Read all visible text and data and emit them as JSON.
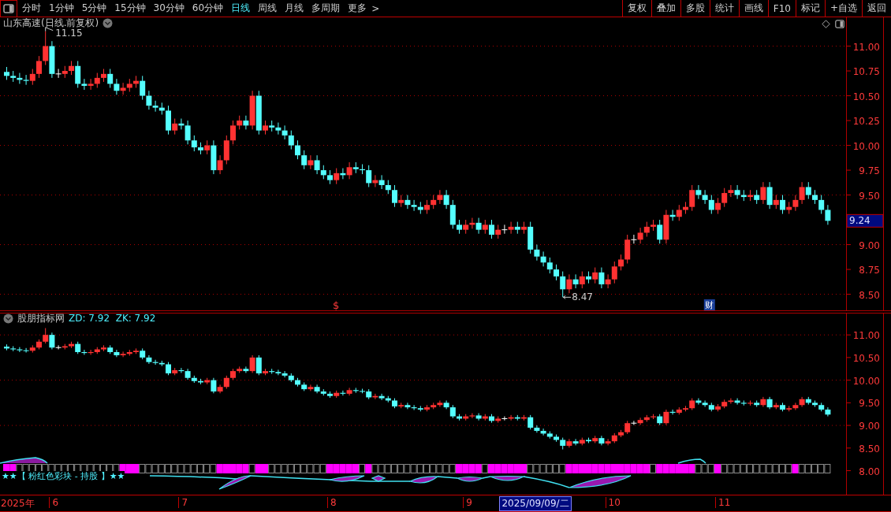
{
  "toolbar": {
    "periods": [
      {
        "label": "分时",
        "selected": false
      },
      {
        "label": "1分钟",
        "selected": false
      },
      {
        "label": "5分钟",
        "selected": false
      },
      {
        "label": "15分钟",
        "selected": false
      },
      {
        "label": "30分钟",
        "selected": false
      },
      {
        "label": "60分钟",
        "selected": false
      },
      {
        "label": "日线",
        "selected": true
      },
      {
        "label": "周线",
        "selected": false
      },
      {
        "label": "月线",
        "selected": false
      },
      {
        "label": "多周期",
        "selected": false
      }
    ],
    "more": "更多",
    "more_arrow": ">",
    "actions": [
      "复权",
      "叠加",
      "多股",
      "统计",
      "画线",
      "F10",
      "标记",
      "+自选",
      "返回"
    ]
  },
  "main_panel": {
    "title": "山东高速(日线.前复权)",
    "last_price": "9.24",
    "markers": [
      {
        "kind": "dollar",
        "text": "$"
      },
      {
        "kind": "finance",
        "text": "财"
      }
    ],
    "chart_data": {
      "type": "candlestick",
      "grid": true,
      "ylim": [
        8.33,
        11.29
      ],
      "categories": [
        null,
        null,
        null,
        null,
        null,
        null,
        null,
        null,
        null,
        null,
        null,
        null,
        null,
        null,
        null,
        null,
        null,
        null,
        null,
        null,
        null,
        null,
        null,
        null,
        null,
        null,
        null,
        null,
        null,
        null,
        null,
        null,
        null,
        null,
        null,
        null,
        null,
        null,
        null,
        null,
        null,
        null,
        null,
        null,
        null,
        null,
        null,
        null,
        null,
        null,
        null,
        null,
        null,
        null,
        null,
        null,
        null,
        null,
        null,
        null,
        null,
        null,
        null,
        null,
        null,
        null,
        null,
        null,
        null,
        null,
        null,
        null,
        null,
        null,
        null,
        null,
        null,
        null,
        null,
        null,
        null,
        null,
        null,
        null,
        null,
        null,
        null,
        null,
        null,
        null,
        null,
        null,
        null,
        null,
        null,
        null,
        null,
        null,
        null,
        null,
        null,
        null,
        null,
        null,
        null,
        null,
        null,
        null,
        null,
        null,
        null,
        null,
        null,
        null,
        null,
        null,
        null,
        null,
        null,
        null,
        null,
        null,
        null,
        null,
        null,
        null,
        null,
        null
      ],
      "yticks": [
        {
          "value": 11,
          "label": "11.00"
        },
        {
          "value": 10.75,
          "label": "10.75"
        },
        {
          "value": 10.5,
          "label": "10.50"
        },
        {
          "value": 10.25,
          "label": "10.25"
        },
        {
          "value": 10,
          "label": "10.00"
        },
        {
          "value": 9.75,
          "label": "9.75"
        },
        {
          "value": 9.5,
          "label": "9.50"
        },
        {
          "value": 9,
          "label": "9.00"
        },
        {
          "value": 8.75,
          "label": "8.75"
        },
        {
          "value": 8.5,
          "label": "8.50"
        }
      ],
      "ohlc": [
        [
          10.74,
          10.79,
          10.66,
          10.7
        ],
        [
          10.7,
          10.75,
          10.64,
          10.68
        ],
        [
          10.68,
          10.73,
          10.62,
          10.66
        ],
        [
          10.66,
          10.71,
          10.61,
          10.65
        ],
        [
          10.65,
          10.77,
          10.61,
          10.72
        ],
        [
          10.72,
          10.9,
          10.68,
          10.85
        ],
        [
          10.85,
          11.15,
          10.81,
          11.0
        ],
        [
          11.0,
          11.05,
          10.68,
          10.72
        ],
        [
          10.72,
          10.77,
          10.68,
          10.72
        ],
        [
          10.72,
          10.8,
          10.68,
          10.75
        ],
        [
          10.75,
          10.85,
          10.71,
          10.8
        ],
        [
          10.8,
          10.85,
          10.58,
          10.62
        ],
        [
          10.62,
          10.67,
          10.56,
          10.6
        ],
        [
          10.6,
          10.67,
          10.56,
          10.62
        ],
        [
          10.62,
          10.73,
          10.58,
          10.68
        ],
        [
          10.68,
          10.77,
          10.64,
          10.72
        ],
        [
          10.72,
          10.77,
          10.58,
          10.62
        ],
        [
          10.62,
          10.67,
          10.51,
          10.55
        ],
        [
          10.55,
          10.63,
          10.51,
          10.58
        ],
        [
          10.58,
          10.67,
          10.54,
          10.62
        ],
        [
          10.62,
          10.7,
          10.58,
          10.65
        ],
        [
          10.65,
          10.7,
          10.46,
          10.5
        ],
        [
          10.5,
          10.55,
          10.36,
          10.4
        ],
        [
          10.4,
          10.45,
          10.34,
          10.38
        ],
        [
          10.38,
          10.43,
          10.31,
          10.35
        ],
        [
          10.35,
          10.4,
          10.11,
          10.15
        ],
        [
          10.15,
          10.27,
          10.11,
          10.22
        ],
        [
          10.22,
          10.27,
          10.16,
          10.2
        ],
        [
          10.2,
          10.25,
          10.01,
          10.05
        ],
        [
          10.05,
          10.1,
          9.94,
          9.98
        ],
        [
          9.98,
          10.03,
          9.91,
          9.95
        ],
        [
          9.95,
          10.05,
          9.91,
          10.0
        ],
        [
          10.0,
          10.05,
          9.71,
          9.75
        ],
        [
          9.75,
          9.9,
          9.71,
          9.85
        ],
        [
          9.85,
          10.1,
          9.81,
          10.05
        ],
        [
          10.05,
          10.25,
          10.01,
          10.2
        ],
        [
          10.2,
          10.3,
          10.16,
          10.25
        ],
        [
          10.25,
          10.3,
          10.16,
          10.2
        ],
        [
          10.2,
          10.55,
          10.16,
          10.5
        ],
        [
          10.5,
          10.55,
          10.11,
          10.15
        ],
        [
          10.15,
          10.25,
          10.11,
          10.2
        ],
        [
          10.2,
          10.25,
          10.14,
          10.18
        ],
        [
          10.18,
          10.23,
          10.11,
          10.15
        ],
        [
          10.15,
          10.2,
          10.06,
          10.1
        ],
        [
          10.1,
          10.15,
          9.96,
          10.0
        ],
        [
          10.0,
          10.05,
          9.86,
          9.9
        ],
        [
          9.9,
          9.95,
          9.76,
          9.8
        ],
        [
          9.8,
          9.9,
          9.76,
          9.85
        ],
        [
          9.85,
          9.9,
          9.71,
          9.75
        ],
        [
          9.75,
          9.8,
          9.66,
          9.7
        ],
        [
          9.7,
          9.75,
          9.61,
          9.65
        ],
        [
          9.65,
          9.77,
          9.61,
          9.72
        ],
        [
          9.72,
          9.77,
          9.66,
          9.7
        ],
        [
          9.7,
          9.83,
          9.66,
          9.78
        ],
        [
          9.78,
          9.83,
          9.72,
          9.76
        ],
        [
          9.76,
          9.81,
          9.71,
          9.75
        ],
        [
          9.75,
          9.8,
          9.58,
          9.62
        ],
        [
          9.62,
          9.7,
          9.58,
          9.65
        ],
        [
          9.65,
          9.7,
          9.56,
          9.6
        ],
        [
          9.6,
          9.65,
          9.51,
          9.55
        ],
        [
          9.55,
          9.6,
          9.38,
          9.42
        ],
        [
          9.42,
          9.5,
          9.38,
          9.45
        ],
        [
          9.45,
          9.5,
          9.36,
          9.4
        ],
        [
          9.4,
          9.45,
          9.34,
          9.38
        ],
        [
          9.38,
          9.43,
          9.31,
          9.35
        ],
        [
          9.35,
          9.45,
          9.31,
          9.4
        ],
        [
          9.4,
          9.5,
          9.36,
          9.45
        ],
        [
          9.45,
          9.55,
          9.41,
          9.5
        ],
        [
          9.5,
          9.55,
          9.36,
          9.4
        ],
        [
          9.4,
          9.45,
          9.16,
          9.2
        ],
        [
          9.2,
          9.25,
          9.11,
          9.15
        ],
        [
          9.15,
          9.25,
          9.11,
          9.2
        ],
        [
          9.2,
          9.27,
          9.16,
          9.22
        ],
        [
          9.22,
          9.27,
          9.11,
          9.15
        ],
        [
          9.15,
          9.25,
          9.11,
          9.2
        ],
        [
          9.2,
          9.25,
          9.06,
          9.1
        ],
        [
          9.1,
          9.2,
          9.06,
          9.15
        ],
        [
          9.15,
          9.2,
          9.11,
          9.15
        ],
        [
          9.15,
          9.23,
          9.11,
          9.18
        ],
        [
          9.18,
          9.23,
          9.11,
          9.15
        ],
        [
          9.15,
          9.23,
          9.11,
          9.18
        ],
        [
          9.18,
          9.23,
          8.91,
          8.95
        ],
        [
          8.95,
          9.0,
          8.84,
          8.88
        ],
        [
          8.88,
          8.93,
          8.78,
          8.82
        ],
        [
          8.82,
          8.87,
          8.71,
          8.75
        ],
        [
          8.75,
          8.8,
          8.64,
          8.68
        ],
        [
          8.68,
          8.73,
          8.47,
          8.55
        ],
        [
          8.55,
          8.7,
          8.51,
          8.65
        ],
        [
          8.65,
          8.7,
          8.56,
          8.6
        ],
        [
          8.6,
          8.73,
          8.56,
          8.68
        ],
        [
          8.68,
          8.73,
          8.61,
          8.65
        ],
        [
          8.65,
          8.77,
          8.61,
          8.72
        ],
        [
          8.72,
          8.77,
          8.56,
          8.6
        ],
        [
          8.6,
          8.7,
          8.56,
          8.65
        ],
        [
          8.65,
          8.83,
          8.61,
          8.78
        ],
        [
          8.78,
          8.9,
          8.74,
          8.85
        ],
        [
          8.85,
          9.1,
          8.81,
          9.05
        ],
        [
          9.05,
          9.1,
          9.01,
          9.05
        ],
        [
          9.05,
          9.17,
          9.01,
          9.12
        ],
        [
          9.12,
          9.23,
          9.08,
          9.18
        ],
        [
          9.18,
          9.25,
          9.14,
          9.2
        ],
        [
          9.2,
          9.25,
          9.01,
          9.05
        ],
        [
          9.05,
          9.35,
          9.01,
          9.3
        ],
        [
          9.3,
          9.35,
          9.24,
          9.28
        ],
        [
          9.28,
          9.4,
          9.24,
          9.35
        ],
        [
          9.35,
          9.43,
          9.31,
          9.38
        ],
        [
          9.38,
          9.6,
          9.34,
          9.55
        ],
        [
          9.55,
          9.6,
          9.46,
          9.5
        ],
        [
          9.5,
          9.55,
          9.41,
          9.45
        ],
        [
          9.45,
          9.5,
          9.31,
          9.35
        ],
        [
          9.35,
          9.47,
          9.31,
          9.42
        ],
        [
          9.42,
          9.57,
          9.38,
          9.52
        ],
        [
          9.52,
          9.6,
          9.48,
          9.55
        ],
        [
          9.55,
          9.6,
          9.46,
          9.5
        ],
        [
          9.5,
          9.55,
          9.44,
          9.48
        ],
        [
          9.48,
          9.55,
          9.44,
          9.5
        ],
        [
          9.5,
          9.55,
          9.41,
          9.45
        ],
        [
          9.45,
          9.63,
          9.41,
          9.58
        ],
        [
          9.58,
          9.63,
          9.36,
          9.4
        ],
        [
          9.4,
          9.5,
          9.36,
          9.45
        ],
        [
          9.45,
          9.5,
          9.31,
          9.35
        ],
        [
          9.35,
          9.43,
          9.31,
          9.38
        ],
        [
          9.38,
          9.5,
          9.34,
          9.45
        ],
        [
          9.45,
          9.63,
          9.41,
          9.58
        ],
        [
          9.58,
          9.63,
          9.46,
          9.5
        ],
        [
          9.5,
          9.55,
          9.41,
          9.45
        ],
        [
          9.45,
          9.5,
          9.31,
          9.35
        ],
        [
          9.35,
          9.4,
          9.2,
          9.24
        ]
      ],
      "annotations": [
        "11.15",
        "8.47"
      ]
    }
  },
  "indicator_panel": {
    "name": "股朋指标网",
    "readings": "ZD: 7.92  ZK: 7.92",
    "chart_data": {
      "type": "candlestick",
      "grid": true,
      "ylim": [
        7.47,
        11.49
      ],
      "categories": [
        null,
        null,
        null,
        null,
        null,
        null,
        null,
        null,
        null,
        null,
        null,
        null,
        null,
        null,
        null,
        null,
        null,
        null,
        null,
        null,
        null,
        null,
        null,
        null,
        null,
        null,
        null,
        null,
        null,
        null,
        null,
        null,
        null,
        null,
        null,
        null,
        null,
        null,
        null,
        null,
        null,
        null,
        null,
        null,
        null,
        null,
        null,
        null,
        null,
        null,
        null,
        null,
        null,
        null,
        null,
        null,
        null,
        null,
        null,
        null,
        null,
        null,
        null,
        null,
        null,
        null,
        null,
        null,
        null,
        null,
        null,
        null,
        null,
        null,
        null,
        null,
        null,
        null,
        null,
        null,
        null,
        null,
        null,
        null,
        null,
        null,
        null,
        null,
        null,
        null,
        null,
        null,
        null,
        null,
        null,
        null,
        null,
        null,
        null,
        null,
        null,
        null,
        null,
        null,
        null,
        null,
        null,
        null,
        null,
        null,
        null,
        null,
        null,
        null,
        null,
        null,
        null,
        null,
        null,
        null,
        null,
        null,
        null,
        null,
        null,
        null,
        null,
        null
      ],
      "yticks": [
        {
          "value": 11,
          "label": "11.00"
        },
        {
          "value": 10.5,
          "label": "10.50"
        },
        {
          "value": 10,
          "label": "10.00"
        },
        {
          "value": 9.5,
          "label": "9.50"
        },
        {
          "value": 9,
          "label": "9.00"
        },
        {
          "value": 8.5,
          "label": "8.50"
        },
        {
          "value": 8,
          "label": "8.00"
        }
      ],
      "ohlc": [
        [
          10.74,
          10.79,
          10.66,
          10.7
        ],
        [
          10.7,
          10.75,
          10.64,
          10.68
        ],
        [
          10.68,
          10.73,
          10.62,
          10.66
        ],
        [
          10.66,
          10.71,
          10.61,
          10.65
        ],
        [
          10.65,
          10.77,
          10.61,
          10.72
        ],
        [
          10.72,
          10.9,
          10.68,
          10.85
        ],
        [
          10.85,
          11.15,
          10.81,
          11.0
        ],
        [
          11.0,
          11.05,
          10.68,
          10.72
        ],
        [
          10.72,
          10.77,
          10.68,
          10.72
        ],
        [
          10.72,
          10.8,
          10.68,
          10.75
        ],
        [
          10.75,
          10.85,
          10.71,
          10.8
        ],
        [
          10.8,
          10.85,
          10.58,
          10.62
        ],
        [
          10.62,
          10.67,
          10.56,
          10.6
        ],
        [
          10.6,
          10.67,
          10.56,
          10.62
        ],
        [
          10.62,
          10.73,
          10.58,
          10.68
        ],
        [
          10.68,
          10.77,
          10.64,
          10.72
        ],
        [
          10.72,
          10.77,
          10.58,
          10.62
        ],
        [
          10.62,
          10.67,
          10.51,
          10.55
        ],
        [
          10.55,
          10.63,
          10.51,
          10.58
        ],
        [
          10.58,
          10.67,
          10.54,
          10.62
        ],
        [
          10.62,
          10.7,
          10.58,
          10.65
        ],
        [
          10.65,
          10.7,
          10.46,
          10.5
        ],
        [
          10.5,
          10.55,
          10.36,
          10.4
        ],
        [
          10.4,
          10.45,
          10.34,
          10.38
        ],
        [
          10.38,
          10.43,
          10.31,
          10.35
        ],
        [
          10.35,
          10.4,
          10.11,
          10.15
        ],
        [
          10.15,
          10.27,
          10.11,
          10.22
        ],
        [
          10.22,
          10.27,
          10.16,
          10.2
        ],
        [
          10.2,
          10.25,
          10.01,
          10.05
        ],
        [
          10.05,
          10.1,
          9.94,
          9.98
        ],
        [
          9.98,
          10.03,
          9.91,
          9.95
        ],
        [
          9.95,
          10.05,
          9.91,
          10.0
        ],
        [
          10.0,
          10.05,
          9.71,
          9.75
        ],
        [
          9.75,
          9.9,
          9.71,
          9.85
        ],
        [
          9.85,
          10.1,
          9.81,
          10.05
        ],
        [
          10.05,
          10.25,
          10.01,
          10.2
        ],
        [
          10.2,
          10.3,
          10.16,
          10.25
        ],
        [
          10.25,
          10.3,
          10.16,
          10.2
        ],
        [
          10.2,
          10.55,
          10.16,
          10.5
        ],
        [
          10.5,
          10.55,
          10.11,
          10.15
        ],
        [
          10.15,
          10.25,
          10.11,
          10.2
        ],
        [
          10.2,
          10.25,
          10.14,
          10.18
        ],
        [
          10.18,
          10.23,
          10.11,
          10.15
        ],
        [
          10.15,
          10.2,
          10.06,
          10.1
        ],
        [
          10.1,
          10.15,
          9.96,
          10.0
        ],
        [
          10.0,
          10.05,
          9.86,
          9.9
        ],
        [
          9.9,
          9.95,
          9.76,
          9.8
        ],
        [
          9.8,
          9.9,
          9.76,
          9.85
        ],
        [
          9.85,
          9.9,
          9.71,
          9.75
        ],
        [
          9.75,
          9.8,
          9.66,
          9.7
        ],
        [
          9.7,
          9.75,
          9.61,
          9.65
        ],
        [
          9.65,
          9.77,
          9.61,
          9.72
        ],
        [
          9.72,
          9.77,
          9.66,
          9.7
        ],
        [
          9.7,
          9.83,
          9.66,
          9.78
        ],
        [
          9.78,
          9.83,
          9.72,
          9.76
        ],
        [
          9.76,
          9.81,
          9.71,
          9.75
        ],
        [
          9.75,
          9.8,
          9.58,
          9.62
        ],
        [
          9.62,
          9.7,
          9.58,
          9.65
        ],
        [
          9.65,
          9.7,
          9.56,
          9.6
        ],
        [
          9.6,
          9.65,
          9.51,
          9.55
        ],
        [
          9.55,
          9.6,
          9.38,
          9.42
        ],
        [
          9.42,
          9.5,
          9.38,
          9.45
        ],
        [
          9.45,
          9.5,
          9.36,
          9.4
        ],
        [
          9.4,
          9.45,
          9.34,
          9.38
        ],
        [
          9.38,
          9.43,
          9.31,
          9.35
        ],
        [
          9.35,
          9.45,
          9.31,
          9.4
        ],
        [
          9.4,
          9.5,
          9.36,
          9.45
        ],
        [
          9.45,
          9.55,
          9.41,
          9.5
        ],
        [
          9.5,
          9.55,
          9.36,
          9.4
        ],
        [
          9.4,
          9.45,
          9.16,
          9.2
        ],
        [
          9.2,
          9.25,
          9.11,
          9.15
        ],
        [
          9.15,
          9.25,
          9.11,
          9.2
        ],
        [
          9.2,
          9.27,
          9.16,
          9.22
        ],
        [
          9.22,
          9.27,
          9.11,
          9.15
        ],
        [
          9.15,
          9.25,
          9.11,
          9.2
        ],
        [
          9.2,
          9.25,
          9.06,
          9.1
        ],
        [
          9.1,
          9.2,
          9.06,
          9.15
        ],
        [
          9.15,
          9.2,
          9.11,
          9.15
        ],
        [
          9.15,
          9.23,
          9.11,
          9.18
        ],
        [
          9.18,
          9.23,
          9.11,
          9.15
        ],
        [
          9.15,
          9.23,
          9.11,
          9.18
        ],
        [
          9.18,
          9.23,
          8.91,
          8.95
        ],
        [
          8.95,
          9.0,
          8.84,
          8.88
        ],
        [
          8.88,
          8.93,
          8.78,
          8.82
        ],
        [
          8.82,
          8.87,
          8.71,
          8.75
        ],
        [
          8.75,
          8.8,
          8.64,
          8.68
        ],
        [
          8.68,
          8.73,
          8.47,
          8.55
        ],
        [
          8.55,
          8.7,
          8.51,
          8.65
        ],
        [
          8.65,
          8.7,
          8.56,
          8.6
        ],
        [
          8.6,
          8.73,
          8.56,
          8.68
        ],
        [
          8.68,
          8.73,
          8.61,
          8.65
        ],
        [
          8.65,
          8.77,
          8.61,
          8.72
        ],
        [
          8.72,
          8.77,
          8.56,
          8.6
        ],
        [
          8.6,
          8.7,
          8.56,
          8.65
        ],
        [
          8.65,
          8.83,
          8.61,
          8.78
        ],
        [
          8.78,
          8.9,
          8.74,
          8.85
        ],
        [
          8.85,
          9.1,
          8.81,
          9.05
        ],
        [
          9.05,
          9.1,
          9.01,
          9.05
        ],
        [
          9.05,
          9.17,
          9.01,
          9.12
        ],
        [
          9.12,
          9.23,
          9.08,
          9.18
        ],
        [
          9.18,
          9.25,
          9.14,
          9.2
        ],
        [
          9.2,
          9.25,
          9.01,
          9.05
        ],
        [
          9.05,
          9.35,
          9.01,
          9.3
        ],
        [
          9.3,
          9.35,
          9.24,
          9.28
        ],
        [
          9.28,
          9.4,
          9.24,
          9.35
        ],
        [
          9.35,
          9.43,
          9.31,
          9.38
        ],
        [
          9.38,
          9.6,
          9.34,
          9.55
        ],
        [
          9.55,
          9.6,
          9.46,
          9.5
        ],
        [
          9.5,
          9.55,
          9.41,
          9.45
        ],
        [
          9.45,
          9.5,
          9.31,
          9.35
        ],
        [
          9.35,
          9.47,
          9.31,
          9.42
        ],
        [
          9.42,
          9.57,
          9.38,
          9.52
        ],
        [
          9.52,
          9.6,
          9.48,
          9.55
        ],
        [
          9.55,
          9.6,
          9.46,
          9.5
        ],
        [
          9.5,
          9.55,
          9.44,
          9.48
        ],
        [
          9.48,
          9.55,
          9.44,
          9.5
        ],
        [
          9.5,
          9.55,
          9.41,
          9.45
        ],
        [
          9.45,
          9.63,
          9.41,
          9.58
        ],
        [
          9.58,
          9.63,
          9.36,
          9.4
        ],
        [
          9.4,
          9.5,
          9.36,
          9.45
        ],
        [
          9.45,
          9.5,
          9.31,
          9.35
        ],
        [
          9.35,
          9.43,
          9.31,
          9.38
        ],
        [
          9.38,
          9.5,
          9.34,
          9.45
        ],
        [
          9.45,
          9.63,
          9.41,
          9.58
        ],
        [
          9.58,
          9.63,
          9.46,
          9.5
        ],
        [
          9.5,
          9.55,
          9.41,
          9.45
        ],
        [
          9.45,
          9.5,
          9.31,
          9.35
        ],
        [
          9.35,
          9.4,
          9.2,
          9.24
        ]
      ]
    },
    "signal_strip": {
      "legend": "★★【 粉红色彩块 - 持股 】★★",
      "holding": [
        true,
        true,
        false,
        false,
        false,
        false,
        false,
        false,
        false,
        false,
        false,
        false,
        false,
        false,
        false,
        false,
        false,
        false,
        true,
        true,
        true,
        false,
        false,
        false,
        false,
        false,
        false,
        false,
        false,
        false,
        false,
        false,
        false,
        true,
        true,
        true,
        true,
        true,
        false,
        true,
        true,
        false,
        false,
        false,
        false,
        false,
        false,
        false,
        false,
        false,
        true,
        true,
        true,
        true,
        true,
        false,
        true,
        false,
        false,
        false,
        false,
        false,
        false,
        false,
        false,
        false,
        false,
        false,
        false,
        false,
        true,
        true,
        true,
        true,
        false,
        true,
        true,
        true,
        true,
        true,
        true,
        false,
        false,
        false,
        false,
        false,
        false,
        true,
        true,
        true,
        true,
        true,
        true,
        true,
        true,
        true,
        true,
        true,
        true,
        true,
        false,
        true,
        true,
        true,
        true,
        true,
        true,
        false,
        false,
        false,
        true,
        false,
        false,
        false,
        false,
        false,
        false,
        false,
        false,
        false,
        false,
        false,
        true,
        false,
        false,
        false,
        false,
        false
      ]
    }
  },
  "date_axis": {
    "labels": [
      "2025年",
      "6",
      "7",
      "8",
      "9",
      "10",
      "11"
    ],
    "cursor": "2025/09/09/二"
  }
}
